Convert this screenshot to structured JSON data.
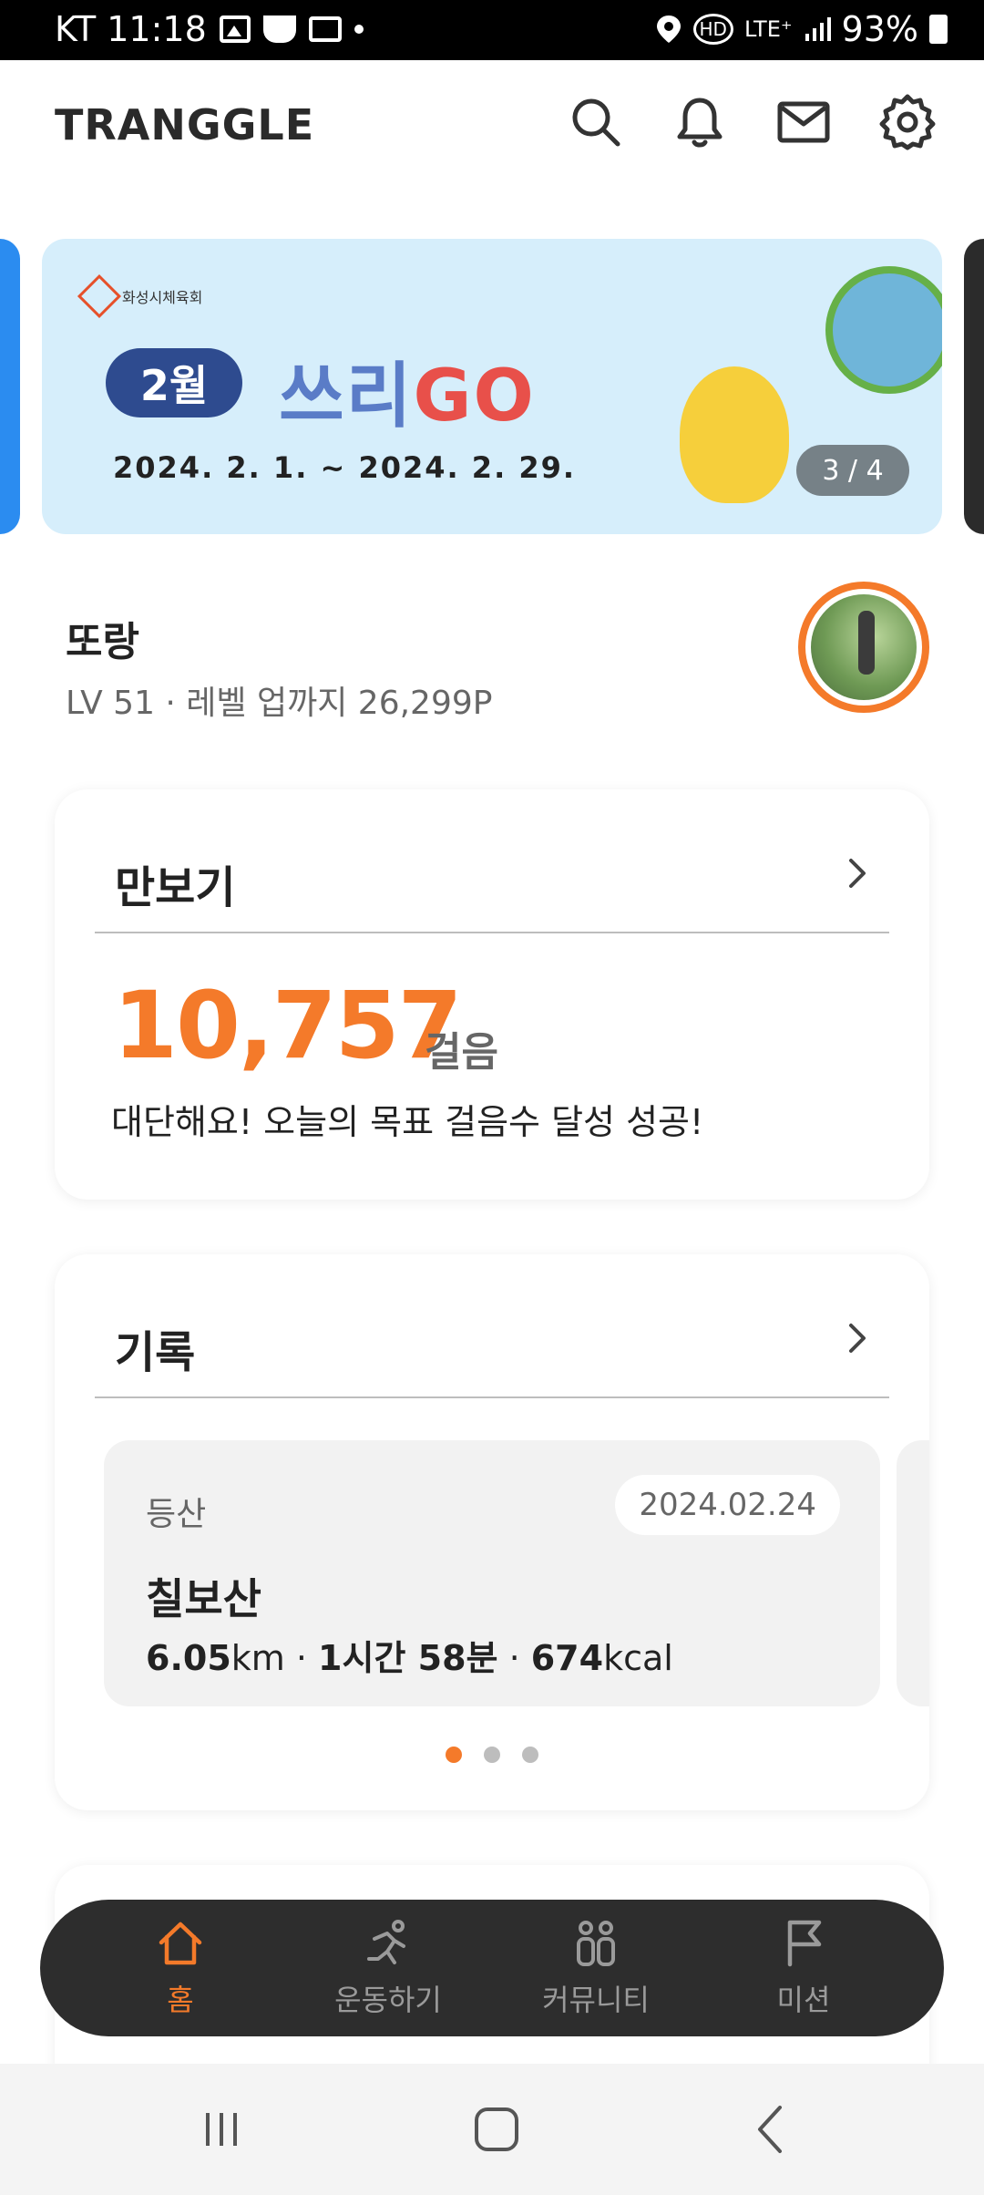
{
  "status_bar": {
    "carrier_time": "KT 11:18",
    "network": "LTE⁺",
    "hd_label": "HD",
    "battery": "93%"
  },
  "header": {
    "logo": "TRANGGLE",
    "icons": [
      "search-icon",
      "bell-icon",
      "mail-icon",
      "gear-icon"
    ]
  },
  "banner": {
    "org": "화성시체육회",
    "month": "2월",
    "title_prefix": "쓰리",
    "title_go": "GO",
    "dates": "2024. 2. 1. ~ 2024. 2. 29.",
    "counter": "3 / 4"
  },
  "profile": {
    "name": "또랑",
    "level_text": "LV 51 · 레벨 업까지 26,299P"
  },
  "steps_card": {
    "title": "만보기",
    "value": "10,757",
    "unit": "걸음",
    "message": "대단해요! 오늘의 목표 걸음수 달성 성공!"
  },
  "record_card": {
    "title": "기록",
    "item": {
      "type": "등산",
      "date": "2024.02.24",
      "name": "칠보산",
      "distance_value": "6.05",
      "distance_unit": "km",
      "duration": "1시간 58분",
      "calories_value": "674",
      "calories_unit": "kcal",
      "separator": " · "
    },
    "page_count": 3,
    "active_page": 1
  },
  "bottom_nav": {
    "items": [
      {
        "label": "홈",
        "icon": "home-icon",
        "active": true
      },
      {
        "label": "운동하기",
        "icon": "running-icon",
        "active": false
      },
      {
        "label": "커뮤니티",
        "icon": "community-icon",
        "active": false
      },
      {
        "label": "미션",
        "icon": "flag-icon",
        "active": false
      }
    ]
  },
  "colors": {
    "accent": "#f47a2a",
    "nav_background": "#2d2d2d",
    "card_background": "#ffffff"
  }
}
